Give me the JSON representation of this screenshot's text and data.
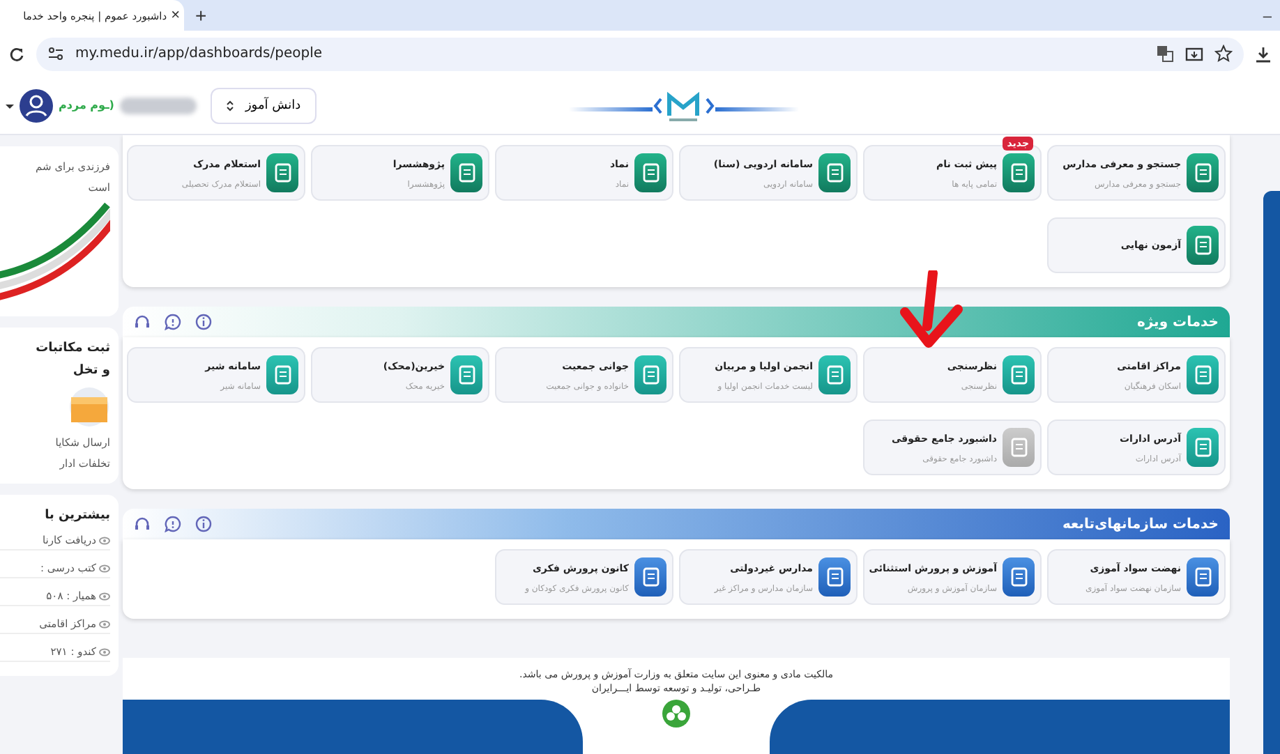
{
  "browser": {
    "tab_title": "داشبورد عموم | پنجره واحد خدما",
    "tab_close": "×",
    "new_tab": "+",
    "minimize": "–",
    "url": "my.medu.ir/app/dashboards/people"
  },
  "header": {
    "user_role": "ـوم مردم)",
    "role_select": "دانش آموز"
  },
  "sidebar": {
    "cards": [
      {
        "kind": "banner",
        "title": "فرزندی برای شم",
        "text": "است"
      },
      {
        "kind": "complaint",
        "title": "ثبت مکاتبات",
        "title_2": "و تخل",
        "text": "ارسال شکایا",
        "text_2": "تخلفات ادار"
      },
      {
        "kind": "stats",
        "title": "بیشترین با",
        "items": [
          "دریافت کارنا",
          "کتب درسی :",
          "همیار : ۵۰۸",
          "مراکز اقامتی",
          "کندو : ۲۷۱"
        ]
      }
    ]
  },
  "sections": [
    {
      "kind": "plain",
      "items": [
        {
          "title": "جستجو و معرفی مدارس",
          "subtitle": "جستجو و معرفی مدارس",
          "disabled": false
        },
        {
          "title": "پیش ثبت نام",
          "subtitle": "تمامی پایه ها",
          "badge": "جدید",
          "disabled": false
        },
        {
          "title": "سامانه اردویی (سنا)",
          "subtitle": "سامانه اردویی",
          "disabled": false
        },
        {
          "title": "نماد",
          "subtitle": "نماد",
          "disabled": false
        },
        {
          "title": "پژوهشسرا",
          "subtitle": "پژوهشسرا",
          "disabled": false
        },
        {
          "title": "استعلام مدرک",
          "subtitle": "استعلام مدرک تحصیلی",
          "disabled": false
        },
        {
          "title": "آزمون نهایی",
          "disabled": false
        }
      ]
    },
    {
      "kind": "teal",
      "title": "خدمات ویژه",
      "items": [
        {
          "title": "مراکز اقامتی",
          "subtitle": "اسکان فرهنگیان",
          "disabled": false
        },
        {
          "title": "نظرسنجی",
          "subtitle": "نظرسنجی",
          "disabled": false
        },
        {
          "title": "انجمن اولیا و مربیان",
          "subtitle": "لیست خدمات انجمن اولیا و",
          "disabled": false
        },
        {
          "title": "جوانی جمعیت",
          "subtitle": "خانواده و جوانی جمعیت",
          "disabled": false
        },
        {
          "title": "خیرین(محک)",
          "subtitle": "خیریه محک",
          "disabled": false
        },
        {
          "title": "سامانه شیر",
          "subtitle": "سامانه شیر",
          "disabled": false
        },
        {
          "title": "آدرس ادارات",
          "subtitle": "آدرس ادارات",
          "disabled": false
        },
        {
          "title": "داشبورد جامع حقوقی",
          "subtitle": "داشبورد جامع حقوقی",
          "disabled": true
        }
      ]
    },
    {
      "kind": "blue",
      "title": "خدمات سازمانهای‌تابعه",
      "items": [
        {
          "title": "نهضت سواد آموزی",
          "subtitle": "سازمان نهضت سواد آموزی",
          "disabled": false
        },
        {
          "title": "آموزش و پرورش استثنائی",
          "subtitle": "سازمان آموزش و پرورش",
          "disabled": false
        },
        {
          "title": "مدارس غیردولتی",
          "subtitle": "سازمان مدارس و مراکز غیر",
          "disabled": false
        },
        {
          "title": "کانون پرورش فکری",
          "subtitle": "کانون پرورش فکری کودکان و",
          "disabled": false
        }
      ]
    }
  ],
  "footer": {
    "lines": [
      "مالکیت مادی و معنوی این سایت متعلق به وزارت آموزش و پرورش می باشد.",
      "طـراحی، تولیـد و توسعه توسط ایـــرایران"
    ]
  }
}
